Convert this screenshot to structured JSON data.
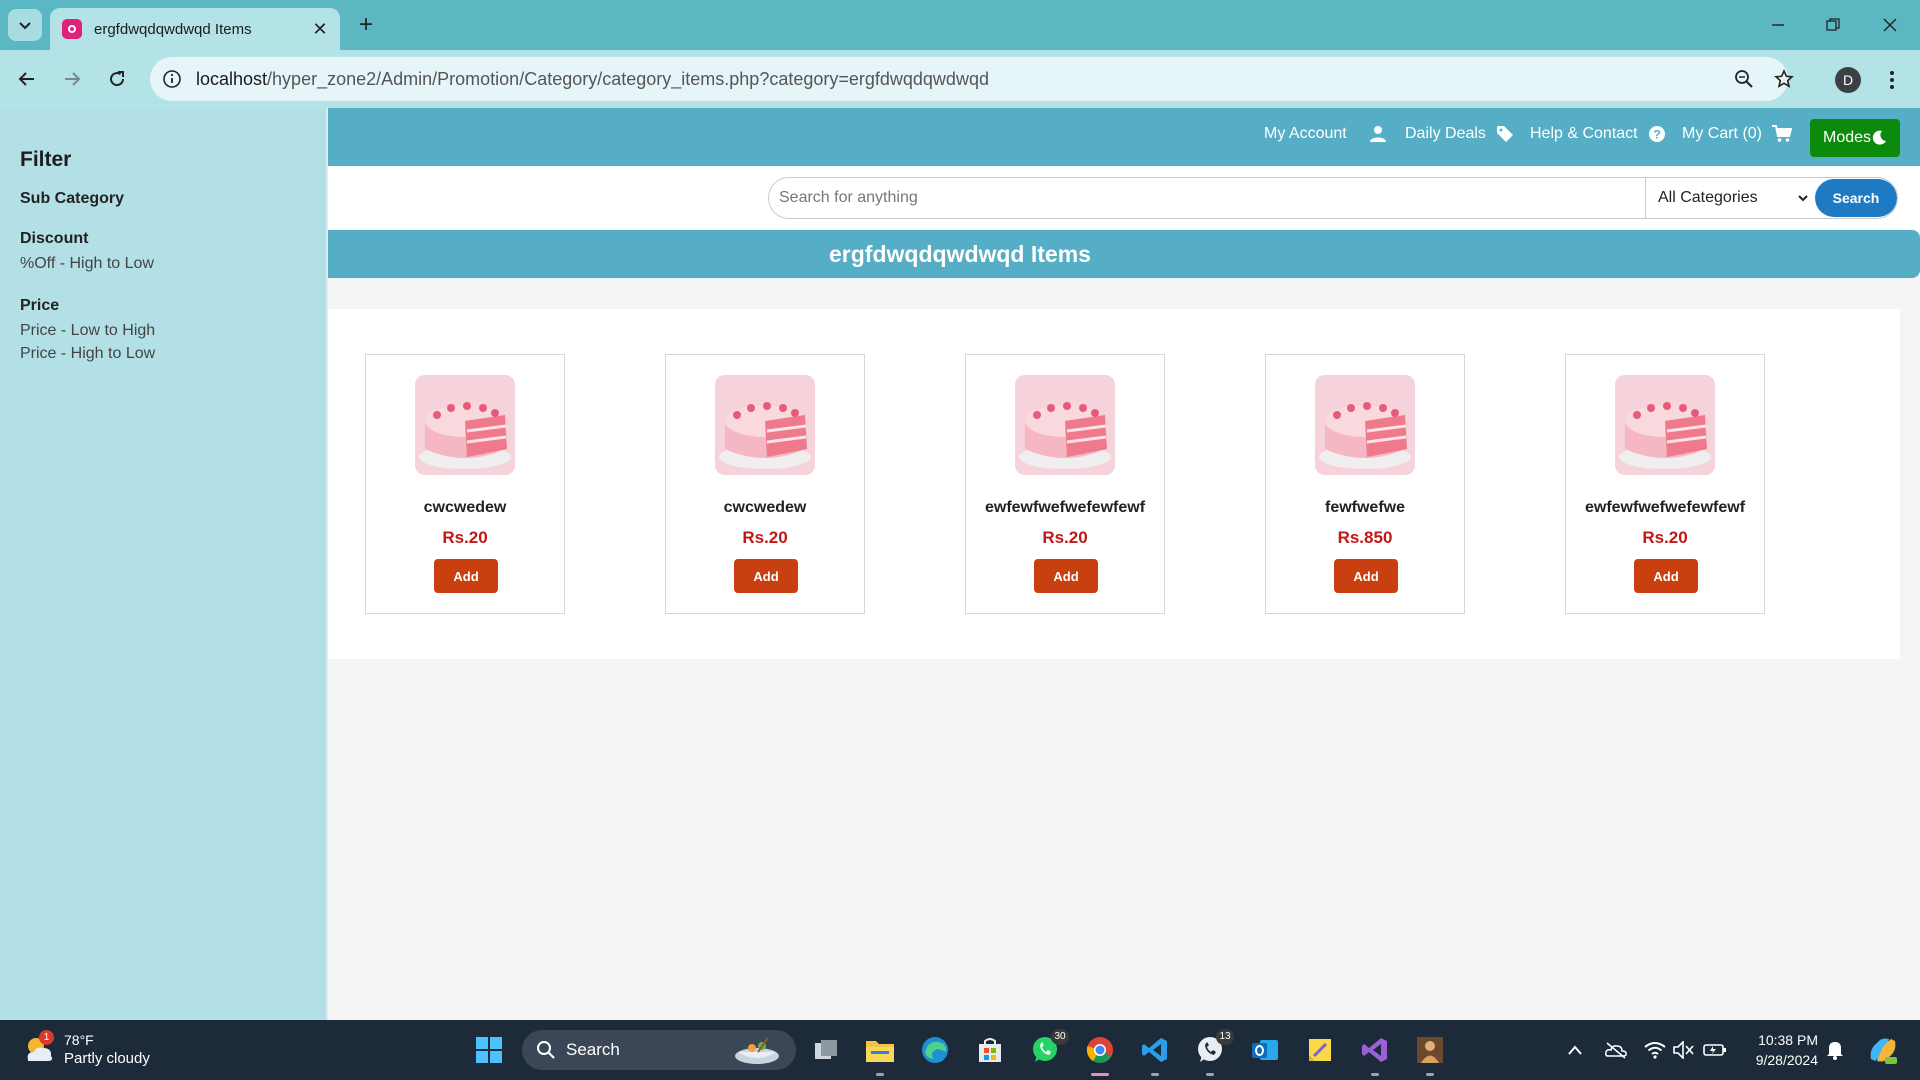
{
  "browser": {
    "tab_title": "ergfdwqdqwdwqd Items",
    "url_host": "localhost",
    "url_path": "/hyper_zone2/Admin/Promotion/Category/category_items.php?category=ergfdwqdqwdwqd",
    "profile_initial": "D"
  },
  "sidebar": {
    "title": "Filter",
    "sub_category": "Sub Category",
    "discount_heading": "Discount",
    "discount_options": [
      "%Off - High to Low"
    ],
    "price_heading": "Price",
    "price_options": [
      "Price - Low to High",
      "Price - High to Low"
    ]
  },
  "topnav": {
    "my_account": "My Account",
    "daily_deals": "Daily Deals",
    "help_contact": "Help & Contact",
    "my_cart": "My Cart (0)",
    "modes": "Modes"
  },
  "search": {
    "placeholder": "Search for anything",
    "category_selected": "All Categories",
    "button": "Search"
  },
  "banner": {
    "title": "ergfdwqdqwdwqd Items"
  },
  "products": [
    {
      "name": "cwcwedew",
      "price": "Rs.20",
      "add_label": "Add"
    },
    {
      "name": "cwcwedew",
      "price": "Rs.20",
      "add_label": "Add"
    },
    {
      "name": "ewfewfwefwefewfewf",
      "price": "Rs.20",
      "add_label": "Add"
    },
    {
      "name": "fewfwefwe",
      "price": "Rs.850",
      "add_label": "Add"
    },
    {
      "name": "ewfewfwefwefewfewf",
      "price": "Rs.20",
      "add_label": "Add"
    }
  ],
  "taskbar": {
    "weather_temp": "78°F",
    "weather_desc": "Partly cloudy",
    "weather_badge": "1",
    "search_label": "Search",
    "whatsapp_badge": "30",
    "whatsapp2_badge": "13",
    "time": "10:38 PM",
    "date": "9/28/2024"
  },
  "colors": {
    "sidebar_bg": "#b2e0e6",
    "nav_bg": "#55aec5",
    "modes_btn": "#0b8a0b",
    "search_btn": "#1f7ac4",
    "add_btn": "#c84010",
    "price_text": "#c01818"
  }
}
